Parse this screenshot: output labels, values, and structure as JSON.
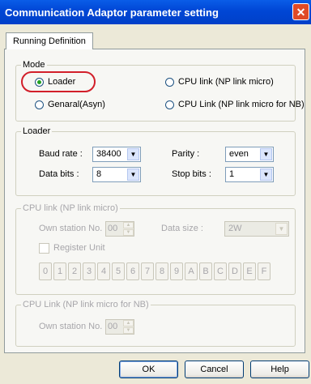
{
  "window": {
    "title": "Communication Adaptor parameter setting",
    "close_glyph": "✕"
  },
  "tabs": [
    {
      "label": "Running Definition"
    }
  ],
  "mode": {
    "legend": "Mode",
    "options": [
      {
        "label": "Loader",
        "selected": true
      },
      {
        "label": "Genaral(Asyn)",
        "selected": false
      },
      {
        "label": "CPU link (NP link micro)",
        "selected": false
      },
      {
        "label": "CPU Link (NP link micro for NB)",
        "selected": false
      }
    ]
  },
  "loader": {
    "legend": "Loader",
    "baud_rate": {
      "label": "Baud rate :",
      "value": "38400"
    },
    "data_bits": {
      "label": "Data bits :",
      "value": "8"
    },
    "parity": {
      "label": "Parity :",
      "value": "even"
    },
    "stop_bits": {
      "label": "Stop bits :",
      "value": "1"
    }
  },
  "cpu_link": {
    "legend": "CPU link (NP link micro)",
    "own_station": {
      "label": "Own station No. :",
      "value": "00"
    },
    "data_size": {
      "label": "Data size :",
      "value": "2W"
    },
    "register_unit": {
      "label": "Register Unit",
      "checked": false
    },
    "bits": [
      "0",
      "1",
      "2",
      "3",
      "4",
      "5",
      "6",
      "7",
      "8",
      "9",
      "A",
      "B",
      "C",
      "D",
      "E",
      "F"
    ]
  },
  "cpu_link_nb": {
    "legend": "CPU Link (NP link micro for NB)",
    "own_station": {
      "label": "Own station No. :",
      "value": "00"
    }
  },
  "buttons": {
    "ok": "OK",
    "cancel": "Cancel",
    "help": "Help"
  },
  "colors": {
    "titlebar": "#0046d5",
    "highlight": "#d21f2a",
    "dialog_bg": "#ece9d8"
  }
}
